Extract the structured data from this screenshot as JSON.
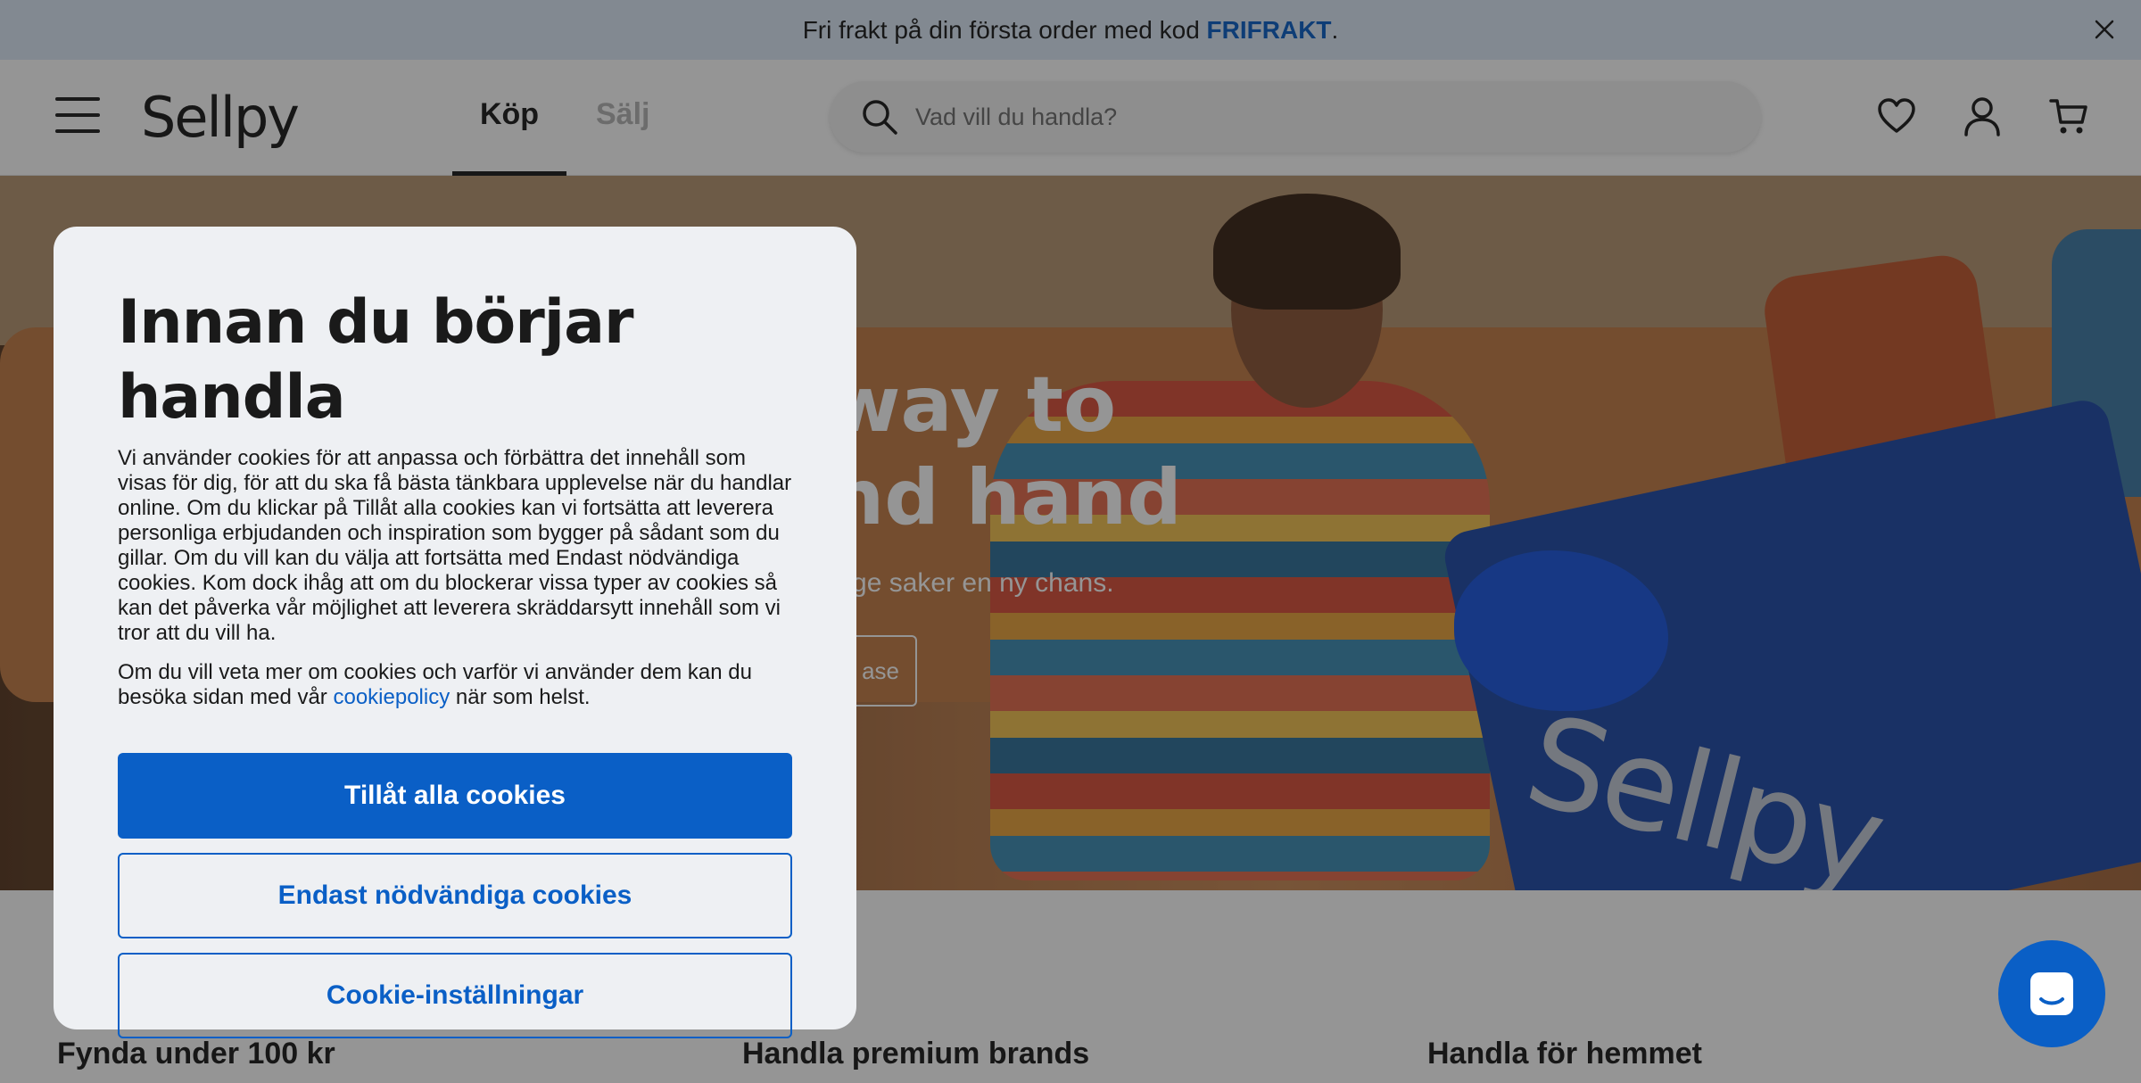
{
  "promo": {
    "text_before": "Fri frakt på din första order med kod ",
    "code": "FRIFRAKT",
    "text_after": "."
  },
  "header": {
    "logo": "Sellpy",
    "tabs": [
      {
        "label": "Köp",
        "active": true
      },
      {
        "label": "Sälj",
        "active": false
      }
    ],
    "search_placeholder": "Vad vill du handla?"
  },
  "hero": {
    "title_line1": "way to",
    "title_line2": "nd hand",
    "subtitle": "a ge saker en ny chans.",
    "button_fragment": "ase",
    "bag_text": "Sellpy"
  },
  "categories": [
    {
      "label": "Fynda under 100 kr"
    },
    {
      "label": "Handla premium brands"
    },
    {
      "label": "Handla för hemmet"
    }
  ],
  "cookie_modal": {
    "title": "Innan du börjar handla",
    "body": "Vi använder cookies för att anpassa och förbättra det innehåll som visas för dig, för att du ska få bästa tänkbara upplevelse när du handlar online. Om du klickar på Tillåt alla cookies kan vi fortsätta att leverera personliga erbjudanden och inspiration som bygger på sådant som du gillar. Om du vill kan du välja att fortsätta med Endast nödvändiga cookies. Kom dock ihåg att om du blockerar vissa typer av cookies så kan det påverka vår möjlighet att leverera skräddarsytt innehåll som vi tror att du vill ha.",
    "info_before": "Om du vill veta mer om cookies och varför vi använder dem kan du besöka sidan med vår ",
    "info_link": "cookiepolicy",
    "info_after": " när som helst.",
    "buttons": {
      "accept_all": "Tillåt alla cookies",
      "necessary_only": "Endast nödvändiga cookies",
      "settings": "Cookie-inställningar"
    }
  },
  "colors": {
    "brand_blue": "#0a5fc6",
    "promo_bg": "#dce9f7",
    "modal_bg": "#eef0f3"
  },
  "icons": [
    "close-icon",
    "hamburger-icon",
    "search-icon",
    "heart-icon",
    "user-icon",
    "cart-icon",
    "chat-icon"
  ]
}
